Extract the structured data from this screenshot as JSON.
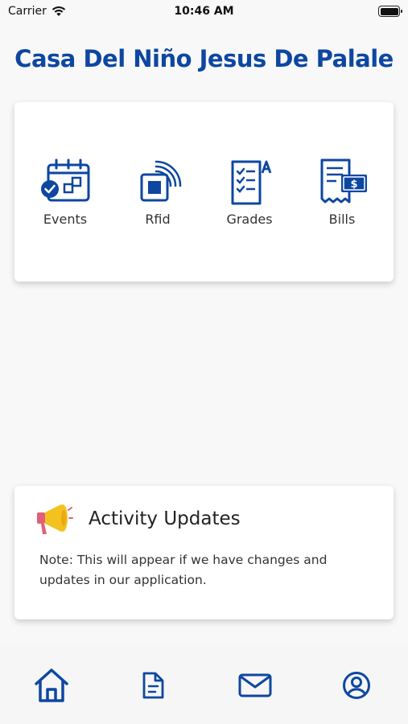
{
  "status_bar": {
    "carrier": "Carrier",
    "time": "10:46 AM"
  },
  "header": {
    "title": "Casa Del Niño Jesus De Palale"
  },
  "menu": {
    "items": [
      {
        "label": "Events",
        "icon": "calendar-check-icon"
      },
      {
        "label": "Rfid",
        "icon": "rfid-signal-icon"
      },
      {
        "label": "Grades",
        "icon": "grades-checklist-icon"
      },
      {
        "label": "Bills",
        "icon": "bill-receipt-icon"
      }
    ]
  },
  "updates": {
    "icon": "megaphone-icon",
    "title": "Activity Updates",
    "note": "Note: This will appear if we have changes and updates in our application."
  },
  "bottom_nav": {
    "items": [
      {
        "icon": "home-icon"
      },
      {
        "icon": "document-icon"
      },
      {
        "icon": "mail-icon"
      },
      {
        "icon": "profile-icon"
      }
    ]
  },
  "colors": {
    "brand": "#0d47a1",
    "megaphone": "#f4c21f",
    "megaphone_body": "#e0607a"
  }
}
